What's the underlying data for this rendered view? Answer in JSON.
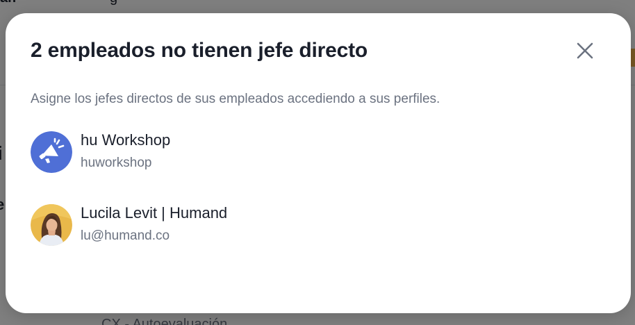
{
  "background": {
    "fragment_top_left": "ar.",
    "fragment_top_mid": "g",
    "fragment_left_1": "i",
    "fragment_left_2": "e",
    "fragment_bottom": "CX - Autoevaluación"
  },
  "modal": {
    "title": "2 empleados no tienen jefe directo",
    "description": "Asigne los jefes directos de sus empleados accediendo a sus perfiles.",
    "close_icon": "close-icon",
    "employees": [
      {
        "name": "hu Workshop",
        "subtitle": "huworkshop",
        "avatar_icon": "megaphone-icon",
        "avatar_color": "#4f6fd6"
      },
      {
        "name": "Lucila Levit | Humand",
        "subtitle": "lu@humand.co",
        "avatar_icon": "user-photo",
        "avatar_color": "#e9b84a"
      }
    ]
  },
  "colors": {
    "title": "#1a1f2b",
    "muted": "#6b7280",
    "overlay": "rgba(0,0,0,0.5)"
  }
}
